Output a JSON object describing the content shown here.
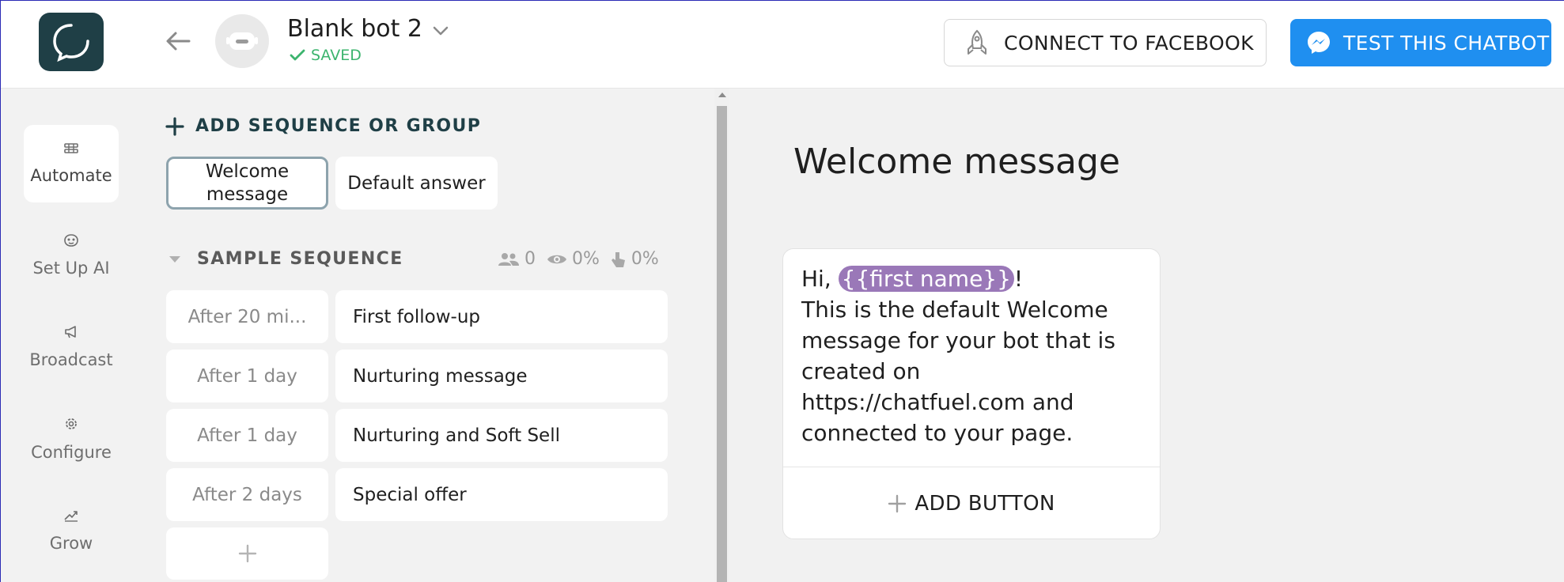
{
  "header": {
    "bot_name": "Blank bot 2",
    "saved_label": "SAVED",
    "connect_facebook_label": "CONNECT TO FACEBOOK",
    "test_chatbot_label": "TEST THIS CHATBOT"
  },
  "sidebar": {
    "items": [
      {
        "label": "Automate",
        "icon": "automate-icon"
      },
      {
        "label": "Set Up AI",
        "icon": "ai-icon"
      },
      {
        "label": "Broadcast",
        "icon": "megaphone-icon"
      },
      {
        "label": "Configure",
        "icon": "gear-icon"
      },
      {
        "label": "Grow",
        "icon": "grow-icon"
      }
    ]
  },
  "blocks_panel": {
    "add_sequence_label": "ADD SEQUENCE OR GROUP",
    "top_blocks": [
      {
        "label": "Welcome message"
      },
      {
        "label": "Default answer"
      }
    ],
    "sequence": {
      "title": "SAMPLE SEQUENCE",
      "stats": {
        "users": "0",
        "seen": "0%",
        "clicked": "0%"
      },
      "rows": [
        {
          "delay": "After 20 mi...",
          "name": "First follow-up"
        },
        {
          "delay": "After 1 day",
          "name": "Nurturing message"
        },
        {
          "delay": "After 1 day",
          "name": "Nurturing and Soft Sell"
        },
        {
          "delay": "After 2 days",
          "name": "Special offer"
        }
      ]
    }
  },
  "editor": {
    "title": "Welcome message",
    "message_prefix": "Hi, ",
    "message_chip": "{{first name}}",
    "message_suffix": "!",
    "message_body": "This is the default Welcome message for your bot that is created on https://chatfuel.com and connected to your page.",
    "add_button_label": "ADD BUTTON"
  },
  "colors": {
    "logo_bg": "#1f3f46",
    "test_button": "#1f8ff0",
    "saved_green": "#3cb46e",
    "chip_purple": "#9a78b8"
  }
}
